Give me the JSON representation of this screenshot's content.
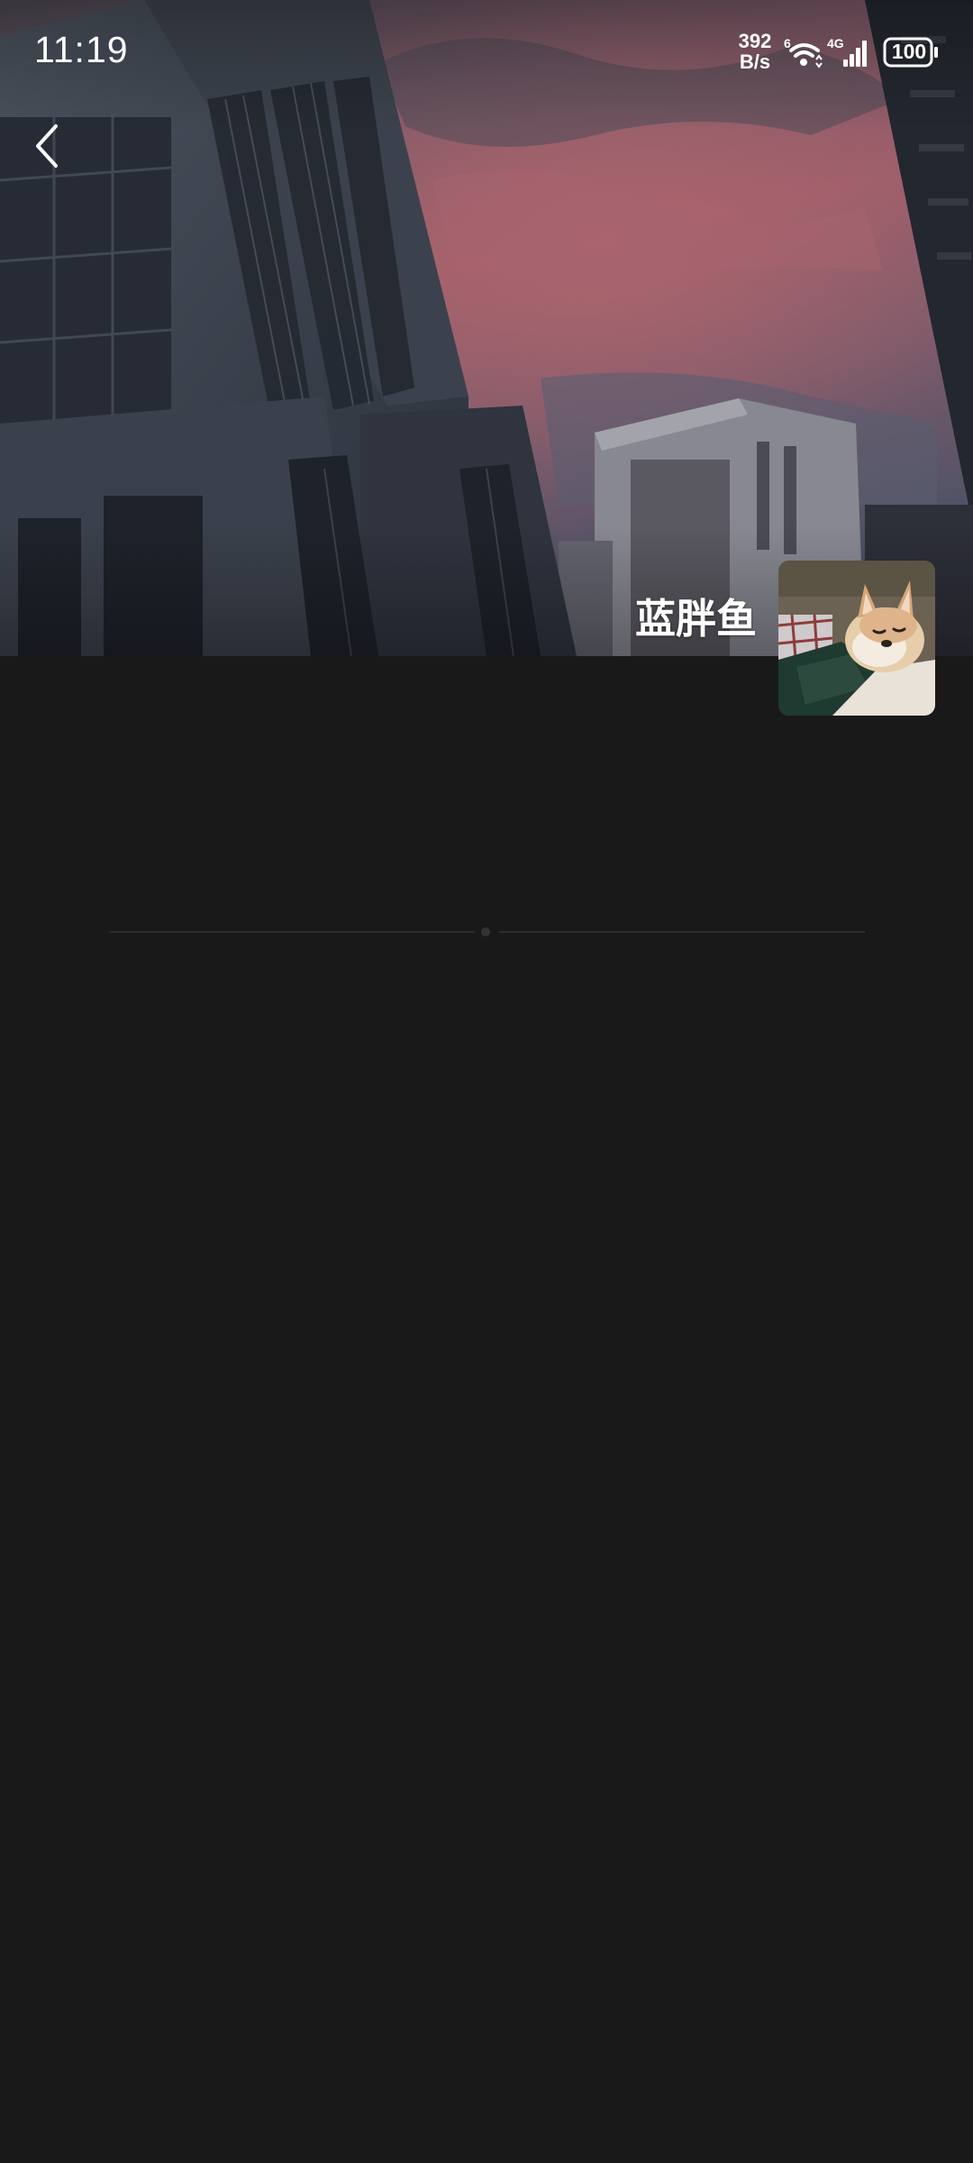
{
  "status_bar": {
    "time": "11:19",
    "net_speed_value": "392",
    "net_speed_unit": "B/s",
    "wifi_badge": "6",
    "cell_badge": "4G",
    "battery": "100"
  },
  "profile": {
    "name": "蓝胖鱼"
  },
  "icons": {
    "back": "chevron-left-icon",
    "wifi": "wifi-icon",
    "signal": "cell-signal-icon",
    "battery": "battery-icon"
  },
  "colors": {
    "background": "#191919",
    "text": "#ffffff",
    "divider": "#2d2d2d"
  }
}
